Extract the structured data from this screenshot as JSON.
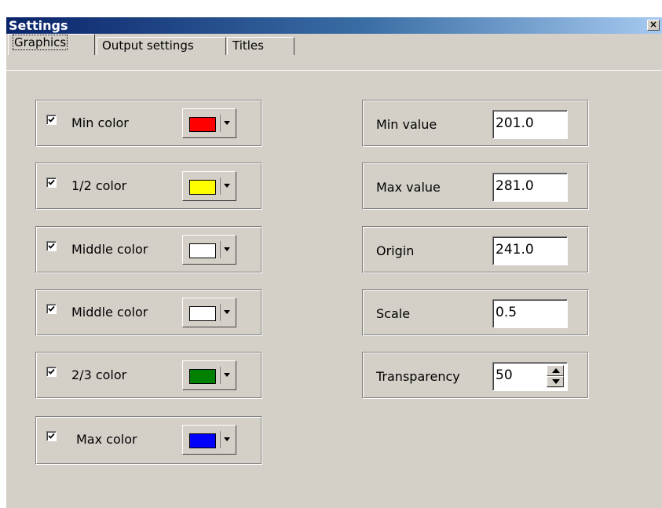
{
  "window": {
    "title": "Settings",
    "close_glyph": "×"
  },
  "tabs": [
    {
      "label": "Graphics",
      "active": true
    },
    {
      "label": "Output settings",
      "active": false
    },
    {
      "label": "Titles",
      "active": false
    }
  ],
  "color_rows": [
    {
      "label": "Min color",
      "checked": true,
      "color": "#ff0000"
    },
    {
      "label": "1/2 color",
      "checked": true,
      "color": "#ffff00"
    },
    {
      "label": "Middle color",
      "checked": true,
      "color": "#ffffff"
    },
    {
      "label": "Middle color",
      "checked": true,
      "color": "#ffffff"
    },
    {
      "label": "2/3 color",
      "checked": true,
      "color": "#008000"
    },
    {
      "label": "Max color",
      "checked": true,
      "color": "#0000ff"
    }
  ],
  "value_rows": [
    {
      "label": "Min value",
      "value": "201.0"
    },
    {
      "label": "Max value",
      "value": "281.0"
    },
    {
      "label": "Origin",
      "value": "241.0"
    },
    {
      "label": "Scale",
      "value": "0.5"
    },
    {
      "label": "Transparency",
      "value": "50",
      "spinner": true
    }
  ]
}
